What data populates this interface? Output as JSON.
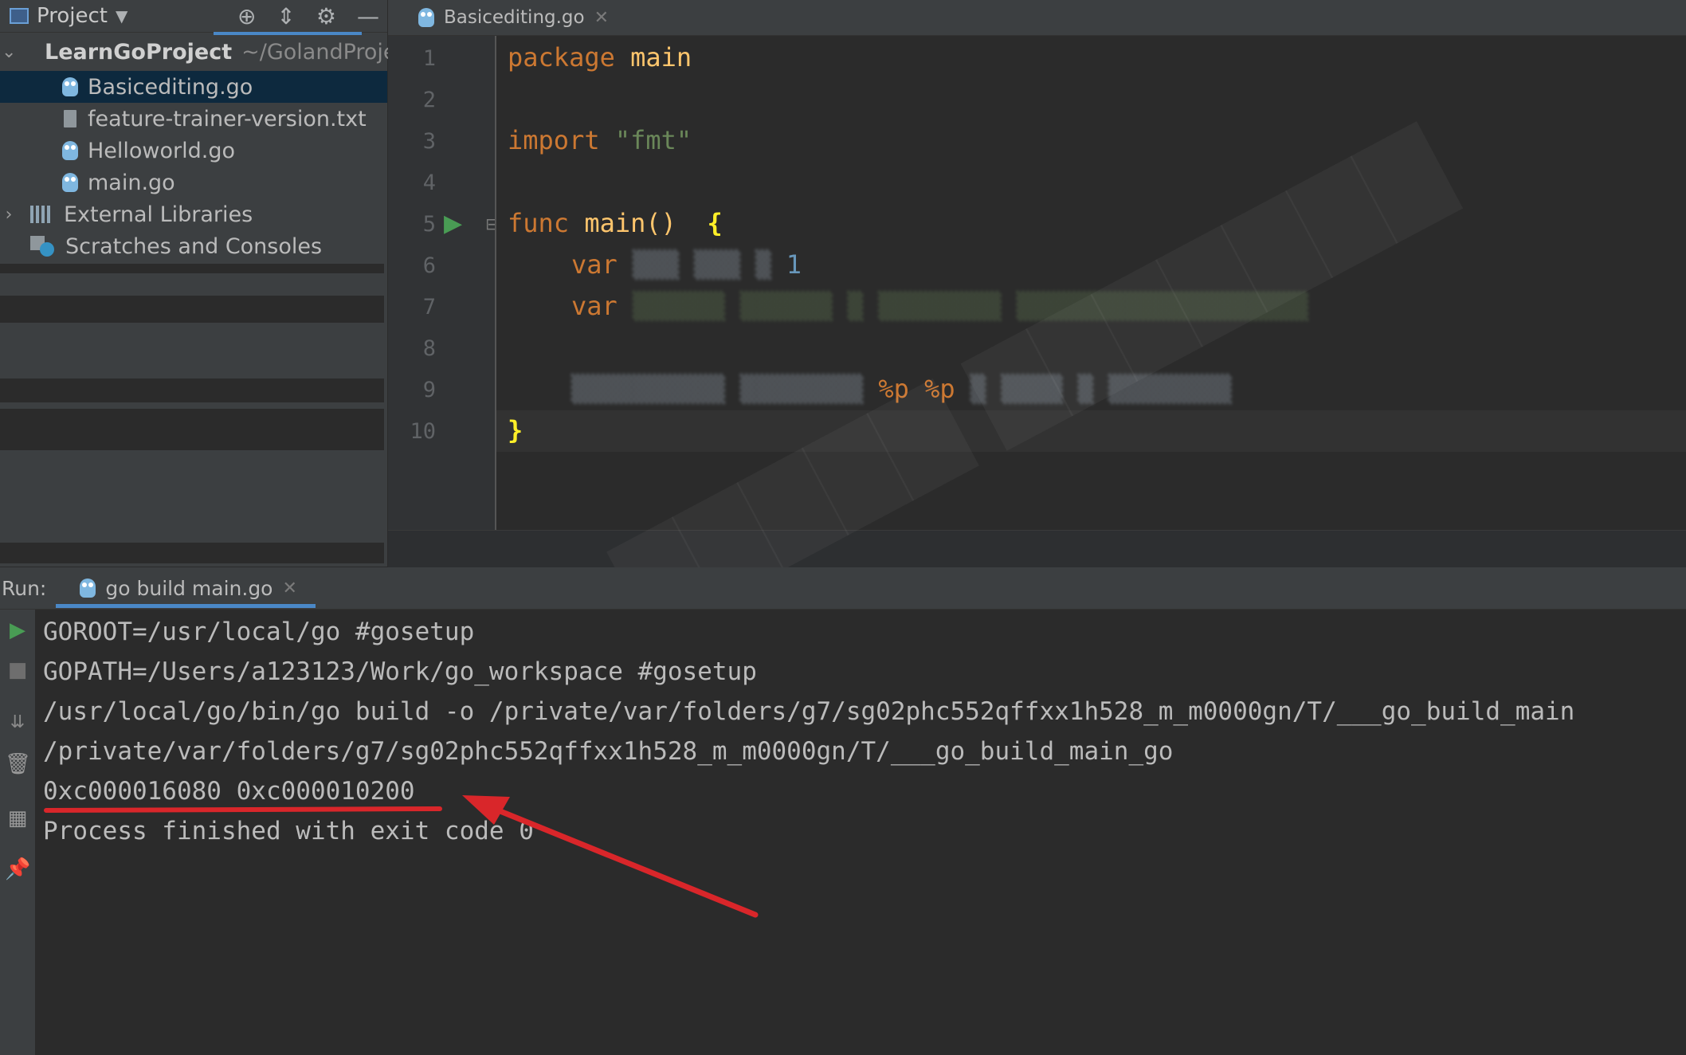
{
  "project_panel": {
    "title": "Project",
    "tree": [
      {
        "label": "LearnGoProject",
        "hint": "~/GolandProjec",
        "type": "project-root"
      },
      {
        "label": "Basicediting.go",
        "type": "go-file",
        "selected": true
      },
      {
        "label": "feature-trainer-version.txt",
        "type": "text-file"
      },
      {
        "label": "Helloworld.go",
        "type": "go-file"
      },
      {
        "label": "main.go",
        "type": "go-file"
      },
      {
        "label": "External Libraries",
        "type": "libraries"
      },
      {
        "label": "Scratches and Consoles",
        "type": "scratches"
      }
    ]
  },
  "editor": {
    "tab_label": "Basicediting.go",
    "line_numbers": [
      "1",
      "2",
      "3",
      "4",
      "5",
      "6",
      "7",
      "8",
      "9",
      "10"
    ],
    "code": {
      "l1_kw": "package",
      "l1_name": "main",
      "l3_kw": "import",
      "l3_str": "\"fmt\"",
      "l5_kw": "func",
      "l5_fn": "main()",
      "l5_brace": "{",
      "l6_kw": "var",
      "l6_val": "1",
      "l7_kw": "var",
      "l9_fmt": "%p %p",
      "l10_brace": "}"
    }
  },
  "run_panel": {
    "label": "Run:",
    "tab_label": "go build main.go",
    "console_lines": [
      "GOROOT=/usr/local/go #gosetup",
      "GOPATH=/Users/a123123/Work/go_workspace #gosetup",
      "/usr/local/go/bin/go build -o /private/var/folders/g7/sg02phc552qffxx1h528_m_m0000gn/T/___go_build_main",
      "/private/var/folders/g7/sg02phc552qffxx1h528_m_m0000gn/T/___go_build_main_go",
      "0xc000016080 0xc000010200",
      "Process finished with exit code 0"
    ]
  },
  "colors": {
    "keyword": "#cc7832",
    "function": "#ffc66d",
    "string": "#6a8759",
    "number": "#6897bb",
    "annotation": "#d9262a",
    "run_green": "#499c54"
  },
  "icons": [
    "project-icon",
    "locate-icon",
    "collapse-icon",
    "gear-icon",
    "minimize-icon",
    "gopher-icon",
    "text-file-icon",
    "folder-icon",
    "libraries-icon",
    "scratches-icon",
    "run-icon",
    "stop-icon",
    "scroll-to-end-icon",
    "trash-icon",
    "layout-icon",
    "pin-icon"
  ]
}
